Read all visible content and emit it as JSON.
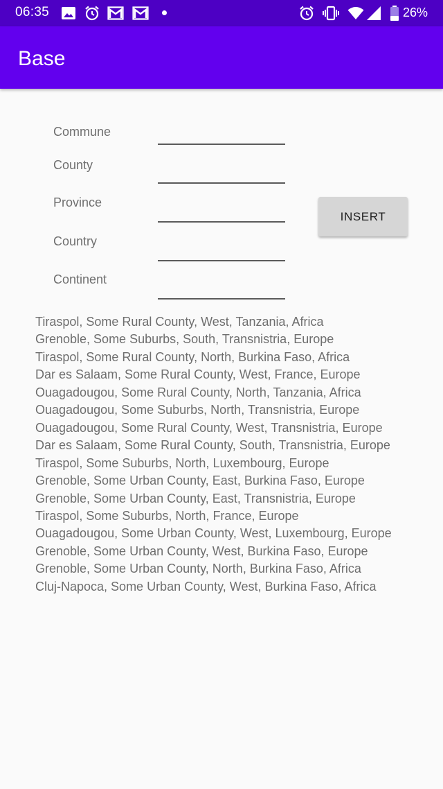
{
  "status_bar": {
    "time": "06:35",
    "battery_percent": "26%",
    "icons": [
      "image-icon",
      "alarm-icon",
      "gmail-icon",
      "gmail-icon",
      "notification-dot",
      "alarm-icon",
      "vibrate-icon",
      "wifi-icon",
      "signal-icon",
      "battery-icon"
    ]
  },
  "app_bar": {
    "title": "Base"
  },
  "form": {
    "fields": [
      {
        "label": "Commune",
        "value": ""
      },
      {
        "label": "County",
        "value": ""
      },
      {
        "label": "Province",
        "value": ""
      },
      {
        "label": "Country",
        "value": ""
      },
      {
        "label": "Continent",
        "value": ""
      }
    ],
    "insert_label": "INSERT"
  },
  "records": [
    "Tiraspol, Some Rural County, West, Tanzania, Africa",
    "Grenoble, Some Suburbs, South, Transnistria, Europe",
    "Tiraspol, Some Rural County, North, Burkina Faso, Africa",
    "Dar es Salaam, Some Rural County, West, France, Europe",
    "Ouagadougou, Some Rural County, North, Tanzania, Africa",
    "Ouagadougou, Some Suburbs, North, Transnistria, Europe",
    "Ouagadougou, Some Rural County, West, Transnistria, Europe",
    "Dar es Salaam, Some Rural County, South, Transnistria, Europe",
    "Tiraspol, Some Suburbs, North, Luxembourg, Europe",
    "Grenoble, Some Urban County, East, Burkina Faso, Europe",
    "Grenoble, Some Urban County, East, Transnistria, Europe",
    "Tiraspol, Some Suburbs, North, France, Europe",
    "Ouagadougou, Some Urban County, West, Luxembourg, Europe",
    "Grenoble, Some Urban County, West, Burkina Faso, Europe",
    "Grenoble, Some Urban County, North, Burkina Faso, Africa",
    "Cluj-Napoca, Some Urban County, West, Burkina Faso, Africa"
  ],
  "colors": {
    "status_bar": "#4d00c4",
    "app_bar": "#6200ee",
    "background": "#fafafa",
    "button": "#d6d6d6",
    "text_secondary": "#6e6e6e"
  }
}
